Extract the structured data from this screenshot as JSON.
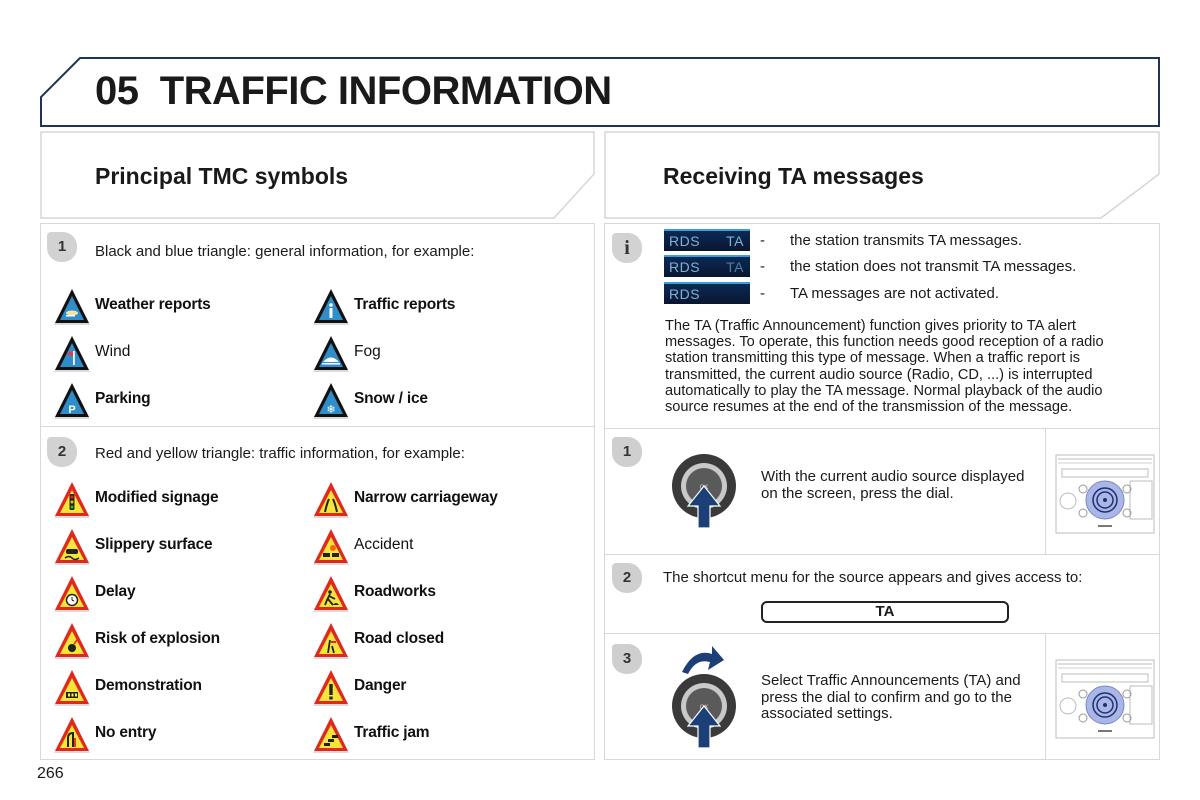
{
  "chapter": {
    "number": "05",
    "title": "TRAFFIC INFORMATION"
  },
  "left_section": {
    "title": "Principal TMC symbols",
    "group1": {
      "badge": "1",
      "intro": "Black and blue triangle: general information, for example:",
      "symbols": [
        {
          "label": "Weather reports",
          "icon": "weather-icon"
        },
        {
          "label": "Traffic reports",
          "icon": "info-icon"
        },
        {
          "label": "Wind",
          "icon": "wind-icon"
        },
        {
          "label": "Fog",
          "icon": "fog-icon"
        },
        {
          "label": "Parking",
          "icon": "parking-icon"
        },
        {
          "label": "Snow / ice",
          "icon": "snowflake-icon"
        }
      ]
    },
    "group2": {
      "badge": "2",
      "intro": "Red and yellow triangle: traffic information, for example:",
      "symbols": [
        {
          "label": "Modified signage",
          "icon": "traffic-light-icon"
        },
        {
          "label": "Narrow carriageway",
          "icon": "narrow-road-icon"
        },
        {
          "label": "Slippery surface",
          "icon": "slippery-icon"
        },
        {
          "label": "Accident",
          "icon": "accident-icon"
        },
        {
          "label": "Delay",
          "icon": "clock-icon"
        },
        {
          "label": "Roadworks",
          "icon": "roadworks-icon"
        },
        {
          "label": "Risk of explosion",
          "icon": "explosion-icon"
        },
        {
          "label": "Road closed",
          "icon": "road-closed-icon"
        },
        {
          "label": "Demonstration",
          "icon": "demonstration-icon"
        },
        {
          "label": "Danger",
          "icon": "exclamation-icon"
        },
        {
          "label": "No entry",
          "icon": "no-entry-icon"
        },
        {
          "label": "Traffic jam",
          "icon": "traffic-jam-icon"
        }
      ]
    }
  },
  "right_section": {
    "title": "Receiving TA messages",
    "info": {
      "badge": "i",
      "rds_rows": [
        {
          "rds": "RDS",
          "ta": "TA",
          "ta_state": "bright",
          "dash": "-",
          "text": "the station transmits TA messages."
        },
        {
          "rds": "RDS",
          "ta": "TA",
          "ta_state": "dim",
          "dash": "-",
          "text": "the station does not transmit TA messages."
        },
        {
          "rds": "RDS",
          "ta": "",
          "ta_state": "none",
          "dash": "-",
          "text": "TA messages are not activated."
        }
      ],
      "paragraph": "The TA (Traffic Announcement) function gives priority to TA alert messages. To operate, this function needs good reception of a radio station transmitting this type of message. When a traffic report is transmitted, the current audio source (Radio, CD, ...) is interrupted automatically to play the TA message. Normal playback of the audio source resumes at the end of the transmission of the message."
    },
    "steps": [
      {
        "badge": "1",
        "text": "With the current audio source displayed on the screen, press the dial."
      },
      {
        "badge": "2",
        "text": "The shortcut menu for the source appears and gives access to:",
        "button": "TA"
      },
      {
        "badge": "3",
        "text": "Select Traffic Announcements (TA) and press the dial to confirm and go to the associated settings."
      }
    ]
  },
  "page_number": "266"
}
